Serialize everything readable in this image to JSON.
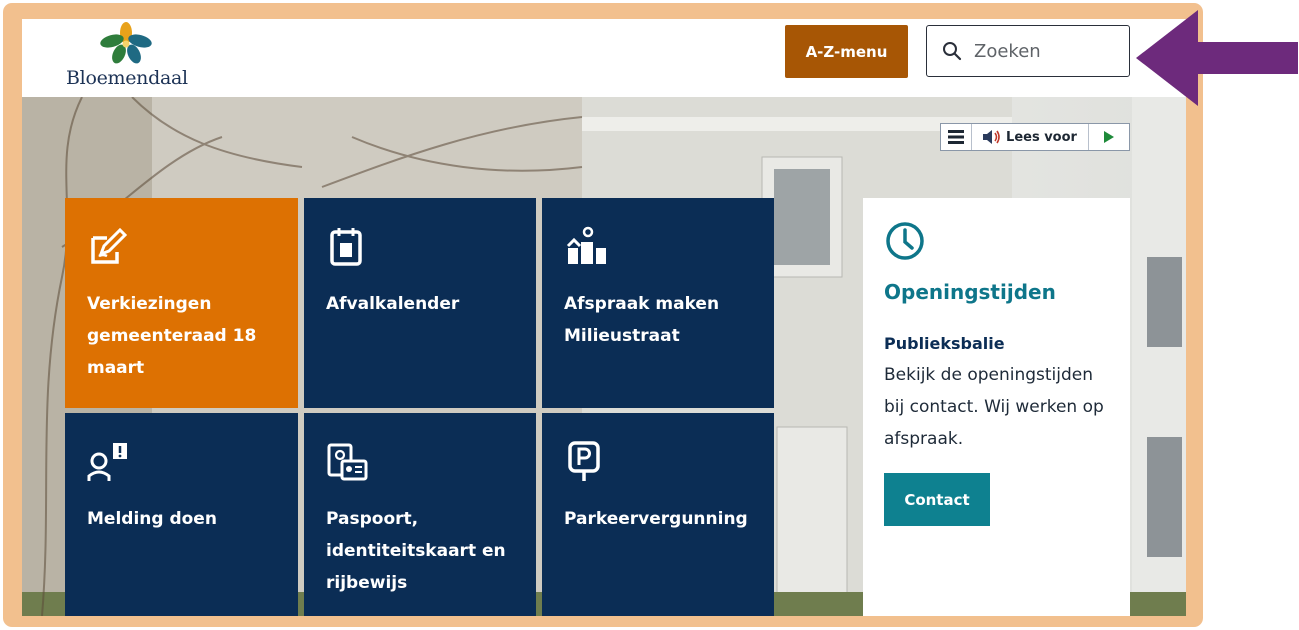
{
  "brand": {
    "name": "Bloemendaal"
  },
  "header": {
    "az_menu_label": "A-Z-menu",
    "search_placeholder": "Zoeken"
  },
  "tts": {
    "read_label": "Lees voor"
  },
  "tiles": [
    {
      "label": "Verkiezingen gemeenteraad 18 maart",
      "icon": "pencil-paper-icon"
    },
    {
      "label": "Afvalkalender",
      "icon": "bin-calendar-icon"
    },
    {
      "label": "Afspraak maken Milieustraat",
      "icon": "recycling-bins-icon"
    },
    {
      "label": "Melding doen",
      "icon": "person-alert-icon"
    },
    {
      "label": "Paspoort, identiteitskaart en rijbewijs",
      "icon": "id-documents-icon"
    },
    {
      "label": "Parkeervergunning",
      "icon": "parking-sign-icon"
    }
  ],
  "opening": {
    "title": "Openingstijden",
    "subtitle": "Publieksbalie",
    "text": "Bekijk de openingstijden bij contact. Wij werken op afspraak.",
    "button_label": "Contact",
    "icon": "clock-icon"
  },
  "colors": {
    "frame": "#f2c08e",
    "navy": "#0b2d55",
    "orange": "#dd7102",
    "az_button": "#a75605",
    "teal": "#0e768a",
    "arrow": "#6d2a7c"
  }
}
